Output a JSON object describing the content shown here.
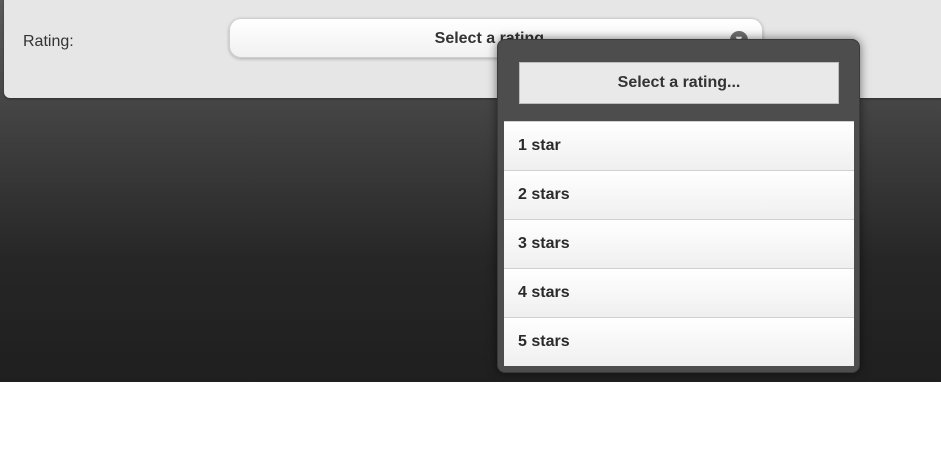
{
  "form": {
    "rating_label": "Rating:",
    "select_value": "Select a rating...",
    "arrow_icon": "circle-arrow-icon"
  },
  "popup": {
    "header": "Select a rating...",
    "options": [
      "1 star",
      "2 stars",
      "3 stars",
      "4 stars",
      "5 stars"
    ]
  }
}
